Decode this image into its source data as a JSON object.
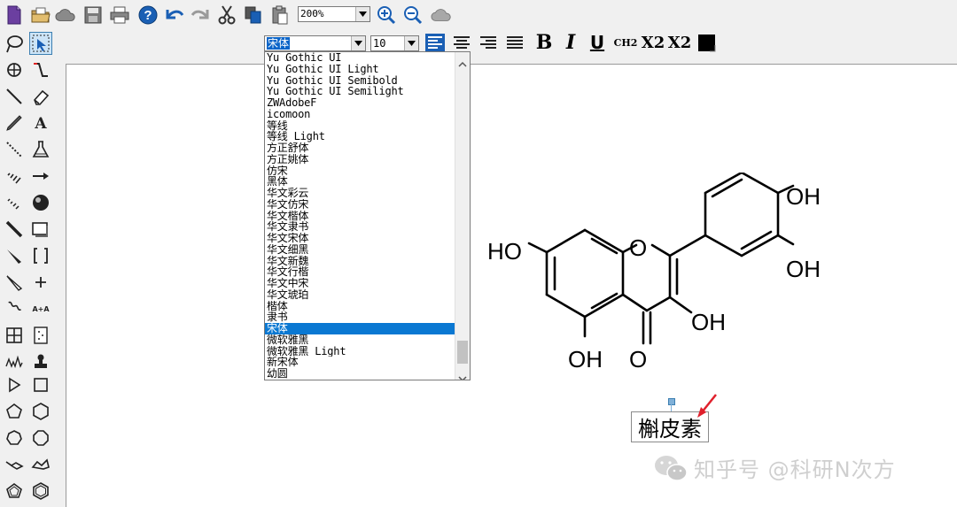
{
  "toolbar": {
    "icons": [
      "new-document-icon",
      "open-folder-icon",
      "cloud-icon",
      "save-icon",
      "print-icon",
      "help-icon",
      "undo-icon",
      "redo-icon",
      "cut-icon",
      "copy-icon",
      "paste-icon"
    ],
    "zoom_value": "200%",
    "zoom_icons": [
      "zoom-in-icon",
      "zoom-out-icon",
      "cloud-gray-icon"
    ]
  },
  "format_bar": {
    "font_value": "宋体",
    "size_value": "10",
    "bold_label": "B",
    "italic_label": "I",
    "underline_label": "U",
    "ch2_label": "CH2",
    "subscript_label": "X2",
    "superscript_label": "X2"
  },
  "font_dropdown": {
    "items": [
      "Yu Gothic UI",
      "Yu Gothic UI Light",
      "Yu Gothic UI Semibold",
      "Yu Gothic UI Semilight",
      "ZWAdobeF",
      "icomoon",
      "等线",
      "等线 Light",
      "方正舒体",
      "方正姚体",
      "仿宋",
      "黑体",
      "华文彩云",
      "华文仿宋",
      "华文楷体",
      "华文隶书",
      "华文宋体",
      "华文细黑",
      "华文新魏",
      "华文行楷",
      "华文中宋",
      "华文琥珀",
      "楷体",
      "隶书",
      "宋体",
      "微软雅黑",
      "微软雅黑 Light",
      "新宋体",
      "幼圆"
    ],
    "selected_index": 24
  },
  "molecule": {
    "labels": {
      "oh_top_right": "OH",
      "oh_right": "OH",
      "ho_left": "HO",
      "oh_c3": "OH",
      "oh_bottom": "OH",
      "o_ring": "O",
      "o_carbonyl": "O"
    }
  },
  "label_text": "槲皮素",
  "watermark": "知乎号 @科研N次方",
  "colors": {
    "selection": "#0a78d2",
    "arrow": "#e0202c"
  }
}
